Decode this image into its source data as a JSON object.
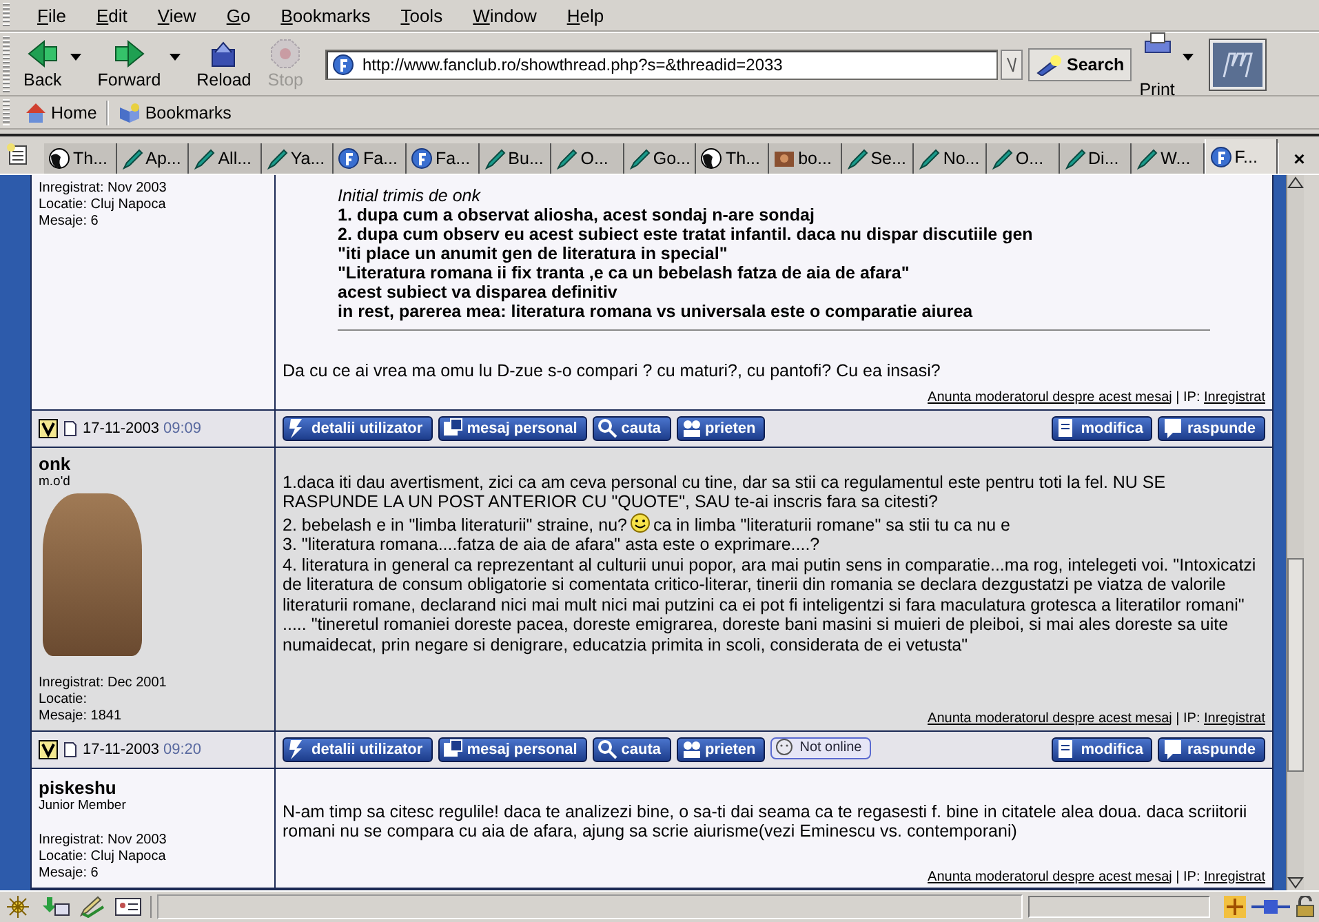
{
  "menu": [
    "File",
    "Edit",
    "View",
    "Go",
    "Bookmarks",
    "Tools",
    "Window",
    "Help"
  ],
  "nav_buttons": [
    {
      "label": "Back",
      "kind": "back",
      "has_menu": true,
      "disabled": false
    },
    {
      "label": "Forward",
      "kind": "forward",
      "has_menu": true,
      "disabled": false
    },
    {
      "label": "Reload",
      "kind": "reload",
      "has_menu": false,
      "disabled": false
    },
    {
      "label": "Stop",
      "kind": "stop",
      "has_menu": false,
      "disabled": true
    }
  ],
  "url": "http://www.fanclub.ro/showthread.php?s=&threadid=2033",
  "search_button": "Search",
  "print_button": "Print",
  "personal_bar": [
    {
      "label": "Home",
      "kind": "home"
    },
    {
      "label": "Bookmarks",
      "kind": "bookmarks"
    }
  ],
  "tabs": [
    {
      "label": "Th...",
      "kind": "globe",
      "selected": false
    },
    {
      "label": "Ap...",
      "kind": "pen",
      "selected": false
    },
    {
      "label": "All...",
      "kind": "pen",
      "selected": false
    },
    {
      "label": "Ya...",
      "kind": "pen",
      "selected": false
    },
    {
      "label": "Fa...",
      "kind": "site",
      "selected": false
    },
    {
      "label": "Fa...",
      "kind": "site",
      "selected": false
    },
    {
      "label": "Bu...",
      "kind": "pen",
      "selected": false
    },
    {
      "label": "O...",
      "kind": "pen",
      "selected": false
    },
    {
      "label": "Go...",
      "kind": "pen",
      "selected": false
    },
    {
      "label": "Th...",
      "kind": "globe",
      "selected": false
    },
    {
      "label": "bo...",
      "kind": "picture",
      "selected": false
    },
    {
      "label": "Se...",
      "kind": "pen",
      "selected": false
    },
    {
      "label": "No...",
      "kind": "pen",
      "selected": false
    },
    {
      "label": "O...",
      "kind": "pen",
      "selected": false
    },
    {
      "label": "Di...",
      "kind": "pen",
      "selected": false
    },
    {
      "label": "W...",
      "kind": "pen",
      "selected": false
    },
    {
      "label": "F...",
      "kind": "site",
      "selected": true
    }
  ],
  "tab_close": "×",
  "posts": [
    {
      "has_avatar": false,
      "info": [
        "Inregistrat: Nov 2003",
        "Locatie: Cluj Napoca",
        "Mesaje: 6"
      ],
      "quote": {
        "header": "Initial trimis de onk",
        "lines": [
          "1. dupa cum a observat aliosha, acest sondaj n-are sondaj",
          "2. dupa cum observ eu acest subiect este tratat infantil. daca nu dispar discutiile gen",
          "\"iti place un anumit gen de literatura in special\"",
          "\"Literatura romana ii fix tranta ,e ca un bebelash fatza de aia de afara\"",
          "acest subiect va disparea definitiv",
          "in rest, parerea mea: literatura romana vs universala este o comparatie aiurea"
        ]
      },
      "paragraphs": [
        {
          "parts": [
            "Da cu ce ai vrea ma omu lu D-zue s-o compari ? cu maturi?, cu pantofi? Cu ea insasi?"
          ]
        }
      ],
      "report_link": "Anunta moderatorul despre acest mesaj",
      "ip_label": " | IP: ",
      "ip_link": "Inregistrat",
      "date": "17-11-2003",
      "time": "09:09",
      "buttons": [
        {
          "label": "detalii utilizator",
          "kind": "profile"
        },
        {
          "label": "mesaj personal",
          "kind": "message"
        },
        {
          "label": "cauta",
          "kind": "search"
        },
        {
          "label": "prieten",
          "kind": "friend"
        },
        {
          "label": "modifica",
          "kind": "edit"
        },
        {
          "label": "raspunde",
          "kind": "reply"
        }
      ]
    },
    {
      "username": "onk",
      "rank": "m.o'd",
      "has_avatar": true,
      "info": [
        "Inregistrat: Dec 2001",
        "Locatie:",
        "Mesaje: 1841"
      ],
      "paragraphs": [
        {
          "parts": [
            "1.daca iti dau avertisment, zici ca am ceva personal cu tine, dar sa stii ca regulamentul este pentru toti la fel. NU SE RASPUNDE LA UN POST ANTERIOR CU \"QUOTE\", SAU te-ai inscris fara sa citesti?"
          ]
        },
        {
          "parts": [
            "2. bebelash e in \"limba literaturii\" straine, nu?",
            "ca in limba \"literaturii romane\" sa stii tu ca nu e"
          ]
        },
        {
          "parts": [
            "3. \"literatura romana....fatza de aia de afara\" asta este o exprimare....?"
          ]
        },
        {
          "parts": [
            "4. literatura in general ca reprezentant al culturii unui popor, ara mai putin sens in comparatie...ma rog, intelegeti voi. \"Intoxicatzi de literatura de consum obligatorie si comentata critico-literar, tinerii din romania se declara dezgustatzi pe viatza de valorile literaturii romane, declarand nici mai mult nici mai putzini ca ei pot fi inteligentzi si fara maculatura grotesca a literatilor romani\" ..... \"tineretul romaniei doreste pacea, doreste emigrarea, doreste bani masini si muieri de pleiboi, si mai ales doreste sa uite numaidecat, prin negare si denigrare, educatzia primita in scoli, considerata de ei vetusta\""
          ]
        }
      ],
      "report_link": "Anunta moderatorul despre acest mesaj",
      "ip_label": " | IP: ",
      "ip_link": "Inregistrat",
      "date": "17-11-2003",
      "time": "09:20",
      "buttons": [
        {
          "label": "detalii utilizator",
          "kind": "profile"
        },
        {
          "label": "mesaj personal",
          "kind": "message"
        },
        {
          "label": "cauta",
          "kind": "search"
        },
        {
          "label": "prieten",
          "kind": "friend"
        },
        {
          "label": "Not online",
          "kind": "status"
        },
        {
          "label": "modifica",
          "kind": "edit"
        },
        {
          "label": "raspunde",
          "kind": "reply"
        }
      ]
    },
    {
      "username": "piskeshu",
      "rank": "Junior Member",
      "has_avatar": false,
      "info": [
        "Inregistrat: Nov 2003",
        "Locatie: Cluj Napoca",
        "Mesaje: 6"
      ],
      "paragraphs": [
        {
          "parts": [
            "N-am timp sa citesc regulile! daca te analizezi bine, o sa-ti dai seama ca te regasesti f. bine in citatele alea doua. daca scriitorii romani nu se compara cu aia de afara, ajung sa scrie aiurisme(vezi Eminescu vs. contemporani)"
          ]
        }
      ],
      "report_link": "Anunta moderatorul despre acest mesaj",
      "ip_label": " | IP: ",
      "ip_link": "Inregistrat"
    }
  ]
}
